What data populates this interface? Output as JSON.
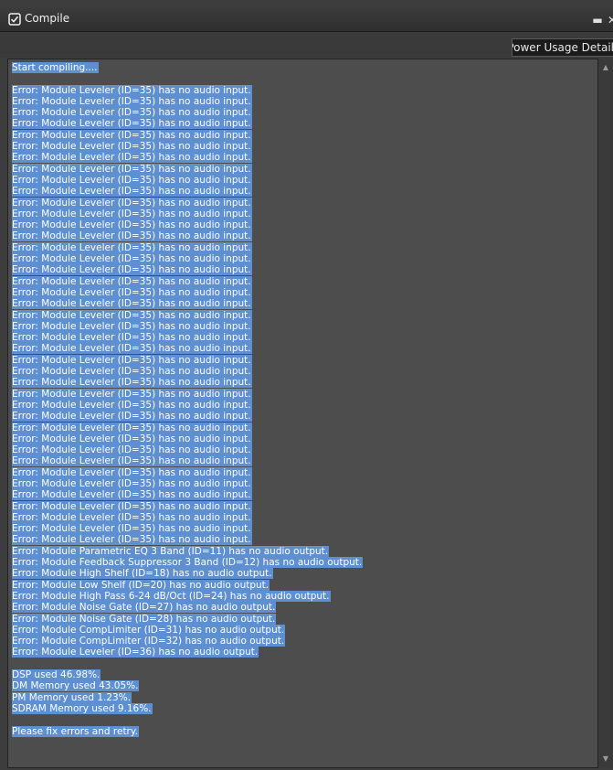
{
  "window": {
    "title": "Compile",
    "max_glyph": "▬",
    "close_glyph": "✕"
  },
  "toolbar": {
    "power_usage_label": "Power Usage Detail"
  },
  "scrollbar": {
    "up_glyph": "▲",
    "down_glyph": "▼"
  },
  "log": {
    "lines": [
      "Start compiling....",
      "",
      "Error: Module Leveler (ID=35) has no audio input.",
      "Error: Module Leveler (ID=35) has no audio input.",
      "Error: Module Leveler (ID=35) has no audio input.",
      "Error: Module Leveler (ID=35) has no audio input.",
      "Error: Module Leveler (ID=35) has no audio input.",
      "Error: Module Leveler (ID=35) has no audio input.",
      "Error: Module Leveler (ID=35) has no audio input.",
      "Error: Module Leveler (ID=35) has no audio input.",
      "Error: Module Leveler (ID=35) has no audio input.",
      "Error: Module Leveler (ID=35) has no audio input.",
      "Error: Module Leveler (ID=35) has no audio input.",
      "Error: Module Leveler (ID=35) has no audio input.",
      "Error: Module Leveler (ID=35) has no audio input.",
      "Error: Module Leveler (ID=35) has no audio input.",
      "Error: Module Leveler (ID=35) has no audio input.",
      "Error: Module Leveler (ID=35) has no audio input.",
      "Error: Module Leveler (ID=35) has no audio input.",
      "Error: Module Leveler (ID=35) has no audio input.",
      "Error: Module Leveler (ID=35) has no audio input.",
      "Error: Module Leveler (ID=35) has no audio input.",
      "Error: Module Leveler (ID=35) has no audio input.",
      "Error: Module Leveler (ID=35) has no audio input.",
      "Error: Module Leveler (ID=35) has no audio input.",
      "Error: Module Leveler (ID=35) has no audio input.",
      "Error: Module Leveler (ID=35) has no audio input.",
      "Error: Module Leveler (ID=35) has no audio input.",
      "Error: Module Leveler (ID=35) has no audio input.",
      "Error: Module Leveler (ID=35) has no audio input.",
      "Error: Module Leveler (ID=35) has no audio input.",
      "Error: Module Leveler (ID=35) has no audio input.",
      "Error: Module Leveler (ID=35) has no audio input.",
      "Error: Module Leveler (ID=35) has no audio input.",
      "Error: Module Leveler (ID=35) has no audio input.",
      "Error: Module Leveler (ID=35) has no audio input.",
      "Error: Module Leveler (ID=35) has no audio input.",
      "Error: Module Leveler (ID=35) has no audio input.",
      "Error: Module Leveler (ID=35) has no audio input.",
      "Error: Module Leveler (ID=35) has no audio input.",
      "Error: Module Leveler (ID=35) has no audio input.",
      "Error: Module Leveler (ID=35) has no audio input.",
      "Error: Module Leveler (ID=35) has no audio input.",
      "Error: Module Parametric EQ 3 Band (ID=11) has no audio output.",
      "Error: Module Feedback Suppressor 3 Band (ID=12) has no audio output.",
      "Error: Module High Shelf (ID=18) has no audio output.",
      "Error: Module Low Shelf (ID=20) has no audio output.",
      "Error: Module High Pass 6-24 dB/Oct (ID=24) has no audio output.",
      "Error: Module Noise Gate (ID=27) has no audio output.",
      "Error: Module Noise Gate (ID=28) has no audio output.",
      "Error: Module CompLimiter (ID=31) has no audio output.",
      "Error: Module CompLimiter (ID=32) has no audio output.",
      "Error: Module Leveler (ID=36) has no audio output.",
      "",
      "DSP used 46.98%.",
      "DM Memory used 43.05%.",
      "PM Memory used 1.23%.",
      "SDRAM Memory used 9.16%.",
      "",
      "Please fix errors and retry."
    ]
  }
}
